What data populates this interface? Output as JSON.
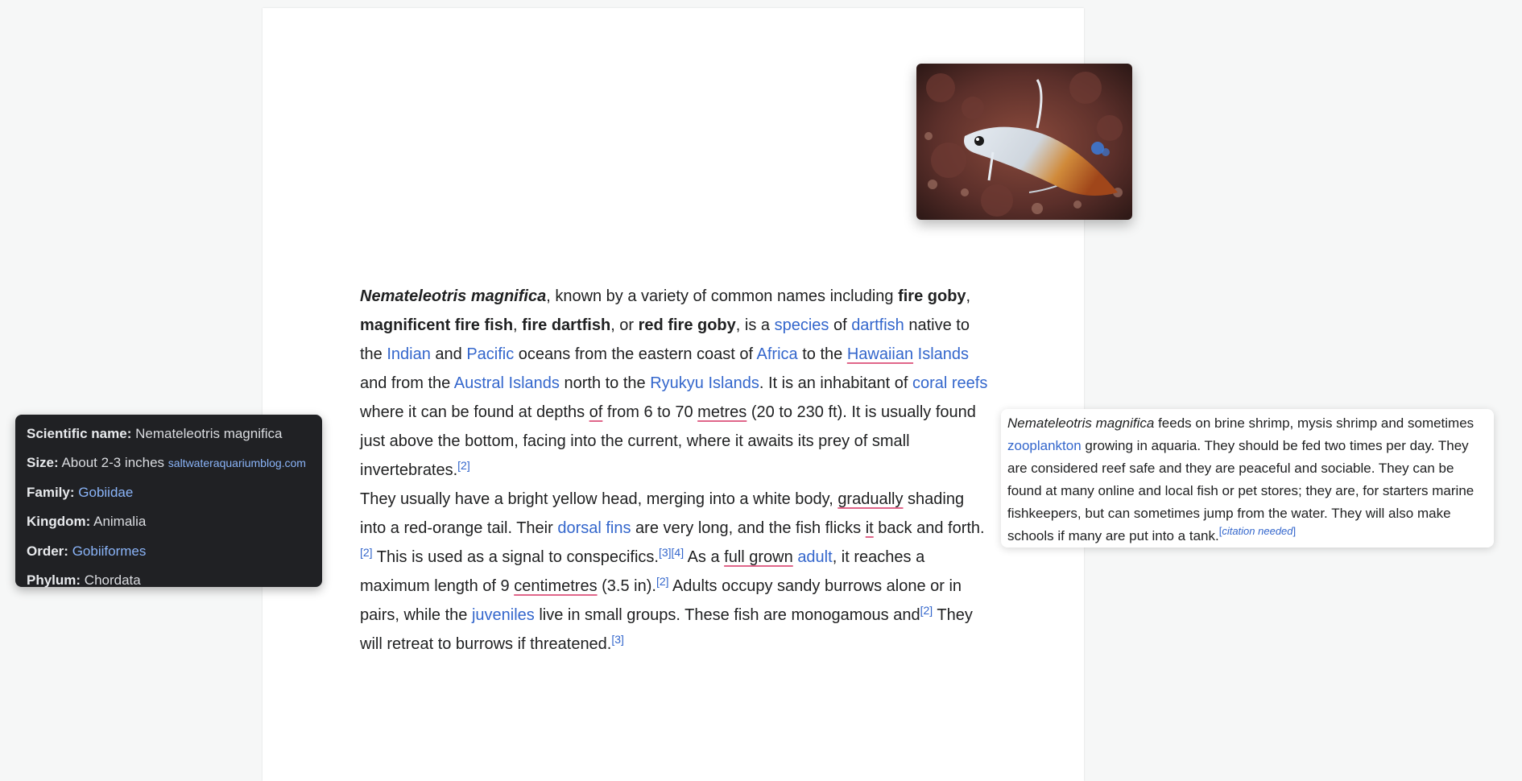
{
  "photo": {
    "alt": "magnificent fire fish"
  },
  "article": {
    "p1": {
      "sci": "Nemateleotris magnifica",
      "t1": ", known by a variety of common names including ",
      "b1": "fire goby",
      "t2": ", ",
      "b2": "magnificent fire fish",
      "t3": ", ",
      "b3": "fire dartfish",
      "t4": ", or ",
      "b4": "red fire goby",
      "t5": ", is a ",
      "l_species": "species",
      "t6": " of ",
      "l_dartfish": "dartfish",
      "t7": " native to the ",
      "l_indian": "Indian",
      "t8": " and ",
      "l_pacific": "Pacific",
      "t9": " oceans from the eastern coast of ",
      "l_africa": "Africa",
      "t10": " to the ",
      "l_hawaiian": "Hawaiian",
      "t10b": " ",
      "l_islands": "Islands",
      "t11": " and from the ",
      "l_austral": "Austral Islands",
      "t12": " north to the ",
      "l_ryukyu": "Ryukyu Islands",
      "t13": ". It is an inhabitant of ",
      "l_coral": "coral reefs",
      "t14": " where it can be found at depths ",
      "w_of": "of",
      "t15": " from 6 to 70 ",
      "w_metres": "metres",
      "t16": " (20 to 230 ft). It is usually found just above the bottom, facing into the current, where it awaits its prey of small invertebrates.",
      "ref2a": "[2]"
    },
    "p2": {
      "t1": "They usually have a bright yellow head, merging into a white body, ",
      "w_gradually": "gradually",
      "t2": " shading into a red-orange tail. Their ",
      "l_dorsal": "dorsal fins",
      "t3": " are very long, and the fish flicks ",
      "w_it": "it",
      "t4": " back and forth.",
      "ref2b": "[2]",
      "t5": " This is used as a signal to conspecifics.",
      "ref3a": "[3]",
      "ref4": "[4]",
      "t6": " As a ",
      "w_full": "full grown",
      "t6b": " ",
      "l_adult": "adult",
      "t7": ", it reaches a maximum length of 9 ",
      "w_cm": "centimetres",
      "t8": " (3.5 in).",
      "ref2c": "[2]",
      "t9": " Adults occupy sandy burrows alone or in pairs, while the ",
      "l_juveniles": "juveniles",
      "t10": " live in small groups. These fish are monogamous and",
      "ref2d": "[2]",
      "t11": " They will retreat to burrows if threatened.",
      "ref3b": "[3]"
    }
  },
  "infobox": {
    "sci_label": "Scientific name:",
    "sci_value": " Nemateleotris magnifica",
    "size_label": "Size:",
    "size_value": " About 2-3 inches ",
    "size_source": "saltwateraquariumblog.com",
    "family_label": "Family:",
    "family_value": "Gobiidae",
    "kingdom_label": "Kingdom:",
    "kingdom_value": " Animalia",
    "order_label": "Order:",
    "order_value": "Gobiiformes",
    "phylum_label": "Phylum:",
    "phylum_value": " Chordata"
  },
  "sidecard": {
    "sci": "Nemateleotris magnifica",
    "t1": " feeds on brine shrimp, mysis shrimp and sometimes ",
    "l_zoo": "zooplankton",
    "t2": " growing in aquaria. They should be fed two times per day. They are considered reef safe and they are peaceful and sociable. They can be found at many online and local fish or pet stores; they are, for starters marine fishkeepers, but can sometimes jump from the water. They will also make schools if many are put into a tank.",
    "cite_open": "[",
    "cite_text": "citation needed",
    "cite_close": "]"
  }
}
